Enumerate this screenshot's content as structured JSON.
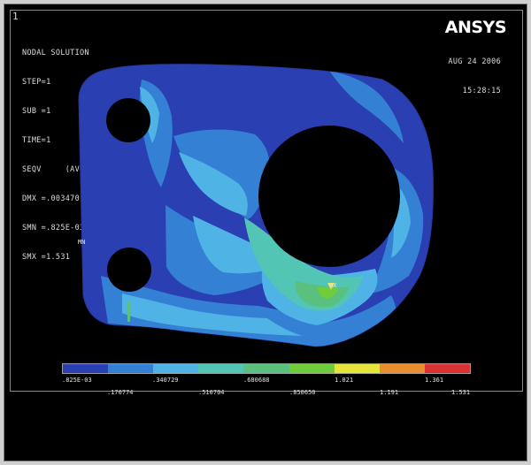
{
  "window": {
    "number": "1"
  },
  "header": {
    "info_lines": [
      "NODAL SOLUTION",
      "STEP=1",
      "SUB =1",
      "TIME=1",
      "SEQV     (AVG)",
      "DMX =.003470",
      "SMN =.825E-03",
      "SMX =1.531"
    ],
    "logo": "ANSYS",
    "date": "AUG 24 2006",
    "time": "15:28:15"
  },
  "labels": {
    "mn": "MN",
    "mx": "MX"
  },
  "legend": {
    "colors": [
      "#2a3fb2",
      "#3380d4",
      "#4fb3e6",
      "#52c5b5",
      "#59c07e",
      "#6fcd3b",
      "#e6e33a",
      "#e98d2d",
      "#d93232"
    ],
    "top_labels": [
      ".825E-03",
      ".340729",
      ".680688",
      "1.021",
      "1.361"
    ],
    "bottom_labels": [
      ".170774",
      ".510704",
      ".850650",
      "1.191",
      "1.531"
    ]
  },
  "colors": {
    "dark_blue": "#2a3fb2",
    "medium_blue": "#3380d4",
    "light_blue": "#4fb3e6",
    "cyan_green": "#52c5b5",
    "green": "#59c07e",
    "lime": "#6fcd3b",
    "yellow": "#e6e33a"
  }
}
